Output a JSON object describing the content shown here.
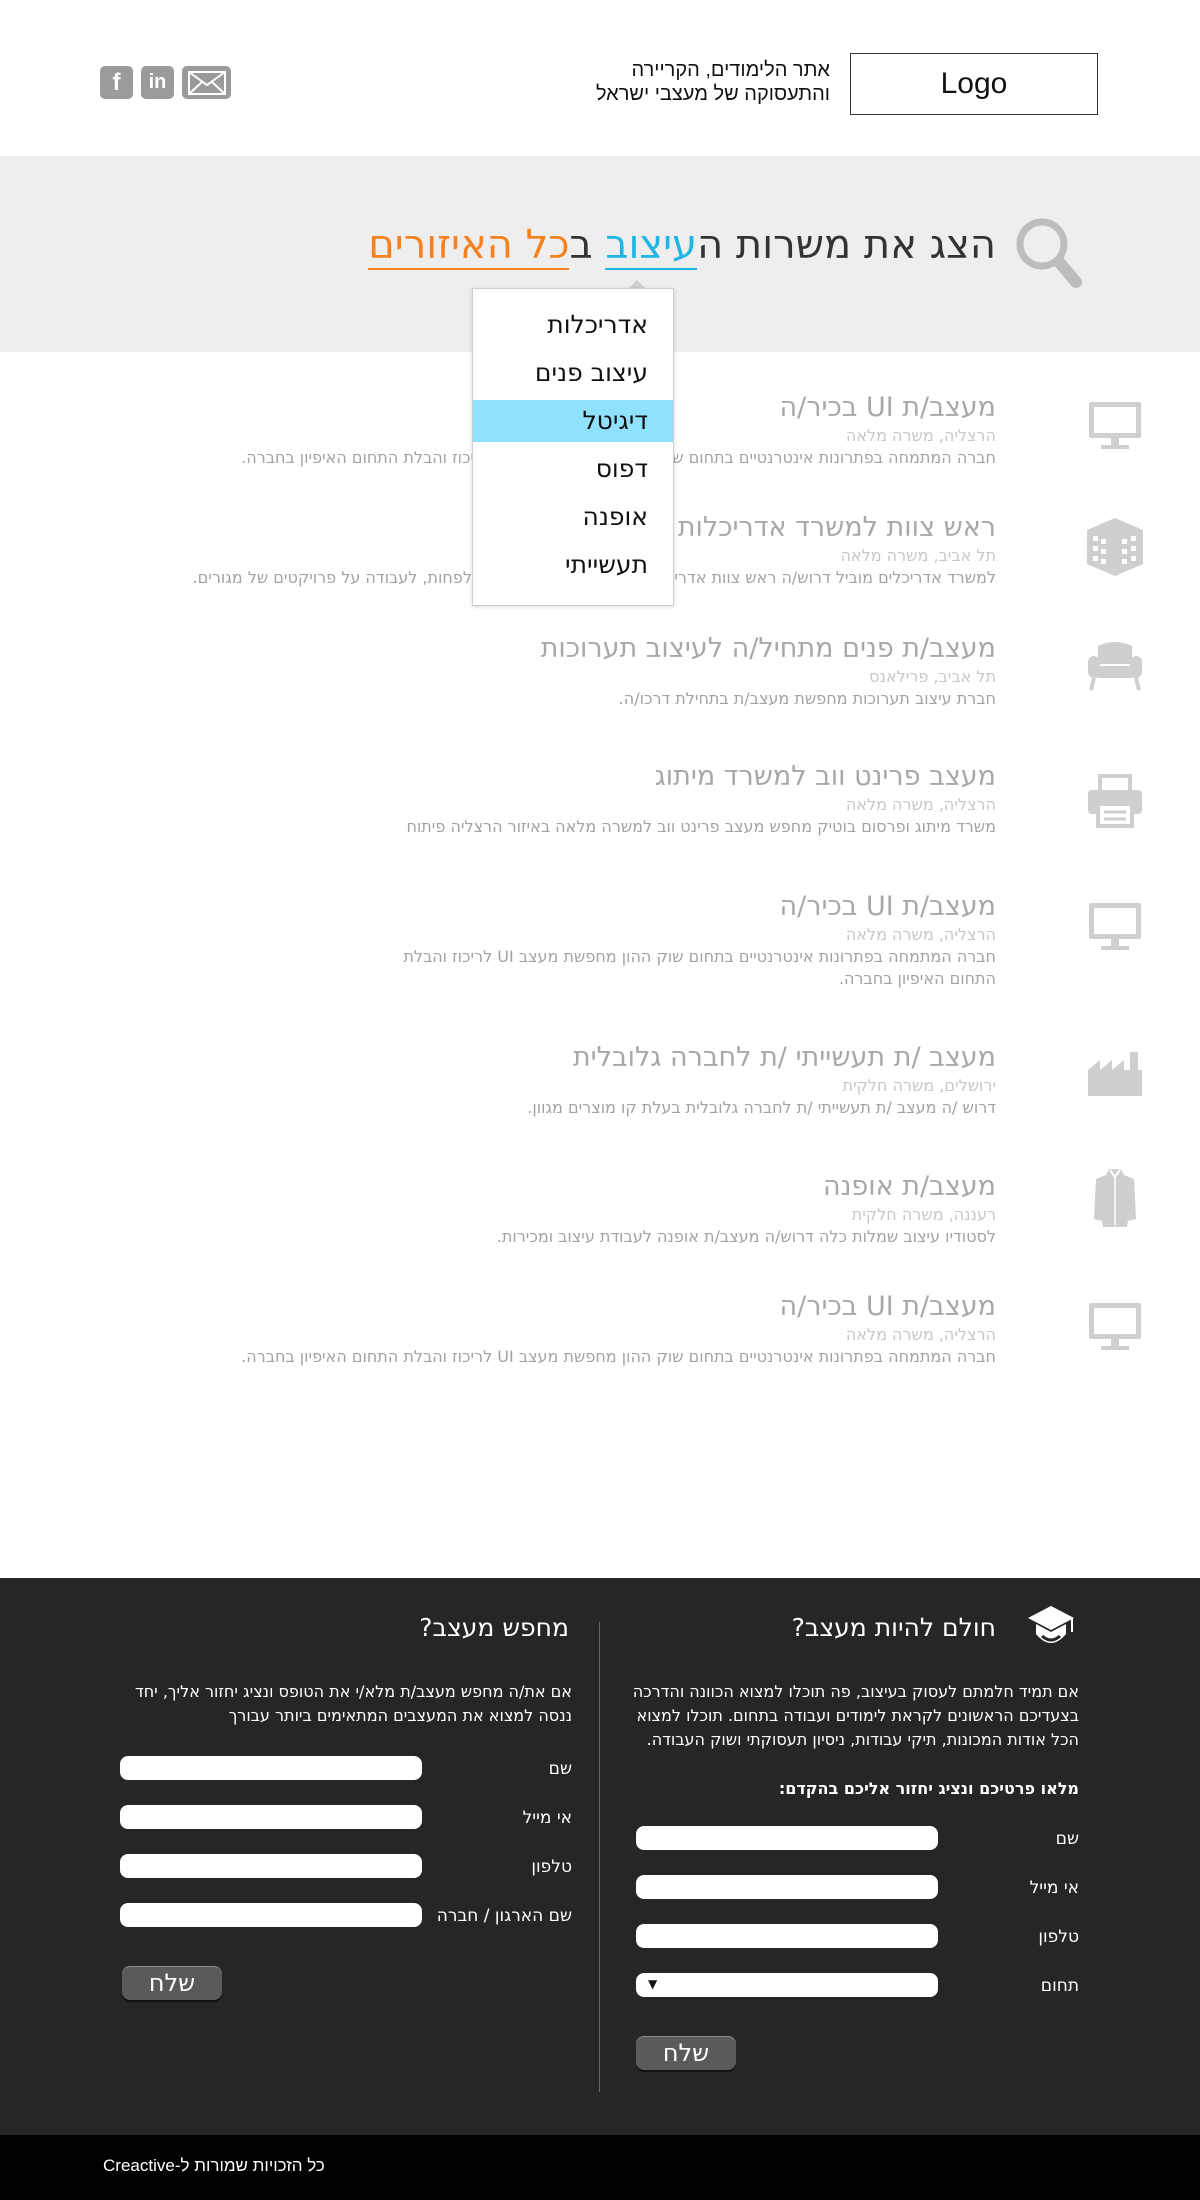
{
  "header": {
    "logo": "Logo",
    "tagline_line1": "אתר הלימודים, הקריירה",
    "tagline_line2": "והתעסוקה של מעצבי ישראל",
    "social": [
      {
        "name": "facebook-icon",
        "glyph": "f"
      },
      {
        "name": "linkedin-icon",
        "glyph": "in"
      },
      {
        "name": "mail-icon",
        "glyph": ""
      }
    ]
  },
  "hero": {
    "title_part1": "הצג את משרות ה",
    "title_highlight1": "עיצוב",
    "title_part2": " ב",
    "title_highlight2": "כל האיזורים",
    "highlight1_color": "#1fb6e6",
    "highlight2_color": "#f5821f"
  },
  "dropdown": {
    "items": [
      "אדריכלות",
      "עיצוב פנים",
      "דיגיטל",
      "דפוס",
      "אופנה",
      "תעשייתי"
    ],
    "selected": "דיגיטל",
    "selected_color": "#8fe1fe"
  },
  "jobs": [
    {
      "title": "מעצב/ת UI בכיר/ה",
      "meta": "הרצליה, משרה מלאה",
      "desc": "חברה המתמחה בפתרונות אינטרנטיים בתחום שוק ההון מחפשת מעצב UI לריכוז והבלת התחום האיפיון בחברה.",
      "icon": "monitor-icon"
    },
    {
      "title": "ראש צוות למשרד אדריכלות",
      "meta": "תל אביב, משרה מלאה",
      "desc": "למשרד אדריכלים מוביל דרוש/ה ראש צוות אדריכלות בעל/ת ניסיון של 4 שנים לפחות, לעבודה על פרויקטים של מגורים.",
      "icon": "building-icon"
    },
    {
      "title": "מעצב/ת פנים מתחיל/ה לעיצוב תערוכות",
      "meta": "תל אביב, פרילאנס",
      "desc": "חברת עיצוב תערוכות מחפשת מעצב/ת בתחילת דרכו/ה.",
      "icon": "armchair-icon"
    },
    {
      "title": "מעצב פרינט ווב למשרד מיתוג",
      "meta": "הרצליה, משרה מלאה",
      "desc": "משרד מיתוג ופרסום בוטיק מחפש מעצב פרינט ווב למשרה מלאה באיזור הרצליה פיתוח",
      "icon": "printer-icon"
    },
    {
      "title": "מעצב/ת UI בכיר/ה",
      "meta": "הרצליה, משרה מלאה",
      "desc": "חברה המתמחה בפתרונות אינטרנטיים בתחום שוק ההון מחפשת מעצב UI לריכוז והבלת התחום האיפיון בחברה.",
      "icon": "monitor-icon"
    },
    {
      "title": "מעצב /ת תעשייתי /ת לחברה גלובלית",
      "meta": "ירושלים, משרה חלקית",
      "desc": "דרוש /ה מעצב /ת תעשייתי /ת לחברה גלובלית בעלת קו מוצרים מגוון.",
      "icon": "factory-icon"
    },
    {
      "title": "מעצב/ת אופנה",
      "meta": "רעננה, משרה חלקית",
      "desc": "לסטודיו עיצוב שמלות כלה דרוש/ה מעצב/ת אופנה לעבודת עיצוב ומכירות.",
      "icon": "shirt-icon"
    },
    {
      "title": "מעצב/ת UI בכיר/ה",
      "meta": "הרצליה, משרה מלאה",
      "desc": "חברה המתמחה בפתרונות אינטרנטיים בתחום שוק ההון מחפשת מעצב UI לריכוז והבלת התחום האיפיון בחברה.",
      "icon": "monitor-icon"
    }
  ],
  "footer": {
    "dream": {
      "title": "חולם להיות מעצב?",
      "text": "אם תמיד חלמתם לעסוק בעיצוב, פה תוכלו למצוא הכוונה והדרכה בצעדיכם הראשונים לקראת לימודים ועבודה בתחום. תוכלו למצוא הכל אודות המכונות, תיקי עבודות, ניסיון תעסוקתי ושוק העבודה.",
      "prompt": "מלאו פרטיכם ונציג יחזור אליכם בהקדם:",
      "fields": [
        "שם",
        "אי מייל",
        "טלפון",
        "תחום"
      ],
      "select_arrow": "▼",
      "submit": "שלח"
    },
    "search": {
      "title": "מחפש מעצב?",
      "text": "אם את/ה מחפש מעצב/ת מלא/י את הטופס ונציג יחזור אליך, יחד ננסה למצוא את המעצבים המתאימים ביותר עבורך",
      "fields": [
        "שם",
        "אי מייל",
        "טלפון",
        "שם הארגון / חברה"
      ],
      "submit": "שלח"
    },
    "copyright": "כל הזכויות שמורות ל-Creactive"
  }
}
